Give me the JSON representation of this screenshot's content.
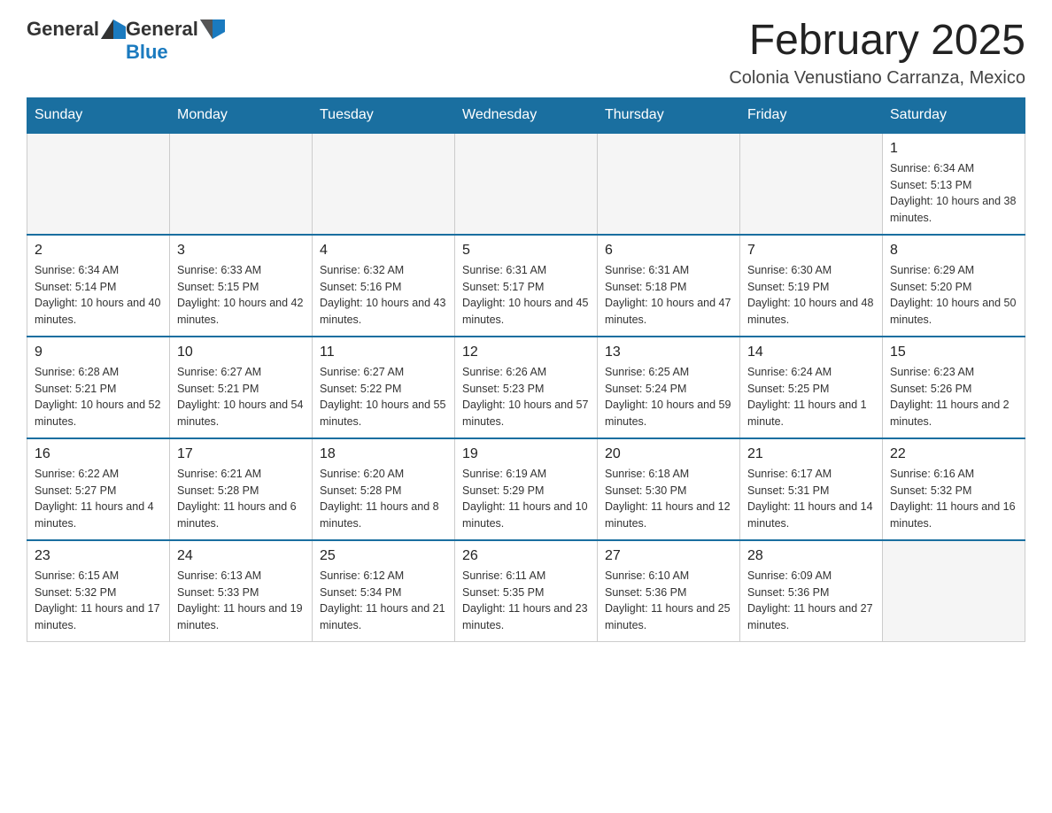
{
  "header": {
    "logo_general": "General",
    "logo_blue": "Blue",
    "month_title": "February 2025",
    "location": "Colonia Venustiano Carranza, Mexico"
  },
  "days_of_week": [
    "Sunday",
    "Monday",
    "Tuesday",
    "Wednesday",
    "Thursday",
    "Friday",
    "Saturday"
  ],
  "weeks": [
    [
      {
        "day": "",
        "info": ""
      },
      {
        "day": "",
        "info": ""
      },
      {
        "day": "",
        "info": ""
      },
      {
        "day": "",
        "info": ""
      },
      {
        "day": "",
        "info": ""
      },
      {
        "day": "",
        "info": ""
      },
      {
        "day": "1",
        "info": "Sunrise: 6:34 AM\nSunset: 5:13 PM\nDaylight: 10 hours and 38 minutes."
      }
    ],
    [
      {
        "day": "2",
        "info": "Sunrise: 6:34 AM\nSunset: 5:14 PM\nDaylight: 10 hours and 40 minutes."
      },
      {
        "day": "3",
        "info": "Sunrise: 6:33 AM\nSunset: 5:15 PM\nDaylight: 10 hours and 42 minutes."
      },
      {
        "day": "4",
        "info": "Sunrise: 6:32 AM\nSunset: 5:16 PM\nDaylight: 10 hours and 43 minutes."
      },
      {
        "day": "5",
        "info": "Sunrise: 6:31 AM\nSunset: 5:17 PM\nDaylight: 10 hours and 45 minutes."
      },
      {
        "day": "6",
        "info": "Sunrise: 6:31 AM\nSunset: 5:18 PM\nDaylight: 10 hours and 47 minutes."
      },
      {
        "day": "7",
        "info": "Sunrise: 6:30 AM\nSunset: 5:19 PM\nDaylight: 10 hours and 48 minutes."
      },
      {
        "day": "8",
        "info": "Sunrise: 6:29 AM\nSunset: 5:20 PM\nDaylight: 10 hours and 50 minutes."
      }
    ],
    [
      {
        "day": "9",
        "info": "Sunrise: 6:28 AM\nSunset: 5:21 PM\nDaylight: 10 hours and 52 minutes."
      },
      {
        "day": "10",
        "info": "Sunrise: 6:27 AM\nSunset: 5:21 PM\nDaylight: 10 hours and 54 minutes."
      },
      {
        "day": "11",
        "info": "Sunrise: 6:27 AM\nSunset: 5:22 PM\nDaylight: 10 hours and 55 minutes."
      },
      {
        "day": "12",
        "info": "Sunrise: 6:26 AM\nSunset: 5:23 PM\nDaylight: 10 hours and 57 minutes."
      },
      {
        "day": "13",
        "info": "Sunrise: 6:25 AM\nSunset: 5:24 PM\nDaylight: 10 hours and 59 minutes."
      },
      {
        "day": "14",
        "info": "Sunrise: 6:24 AM\nSunset: 5:25 PM\nDaylight: 11 hours and 1 minute."
      },
      {
        "day": "15",
        "info": "Sunrise: 6:23 AM\nSunset: 5:26 PM\nDaylight: 11 hours and 2 minutes."
      }
    ],
    [
      {
        "day": "16",
        "info": "Sunrise: 6:22 AM\nSunset: 5:27 PM\nDaylight: 11 hours and 4 minutes."
      },
      {
        "day": "17",
        "info": "Sunrise: 6:21 AM\nSunset: 5:28 PM\nDaylight: 11 hours and 6 minutes."
      },
      {
        "day": "18",
        "info": "Sunrise: 6:20 AM\nSunset: 5:28 PM\nDaylight: 11 hours and 8 minutes."
      },
      {
        "day": "19",
        "info": "Sunrise: 6:19 AM\nSunset: 5:29 PM\nDaylight: 11 hours and 10 minutes."
      },
      {
        "day": "20",
        "info": "Sunrise: 6:18 AM\nSunset: 5:30 PM\nDaylight: 11 hours and 12 minutes."
      },
      {
        "day": "21",
        "info": "Sunrise: 6:17 AM\nSunset: 5:31 PM\nDaylight: 11 hours and 14 minutes."
      },
      {
        "day": "22",
        "info": "Sunrise: 6:16 AM\nSunset: 5:32 PM\nDaylight: 11 hours and 16 minutes."
      }
    ],
    [
      {
        "day": "23",
        "info": "Sunrise: 6:15 AM\nSunset: 5:32 PM\nDaylight: 11 hours and 17 minutes."
      },
      {
        "day": "24",
        "info": "Sunrise: 6:13 AM\nSunset: 5:33 PM\nDaylight: 11 hours and 19 minutes."
      },
      {
        "day": "25",
        "info": "Sunrise: 6:12 AM\nSunset: 5:34 PM\nDaylight: 11 hours and 21 minutes."
      },
      {
        "day": "26",
        "info": "Sunrise: 6:11 AM\nSunset: 5:35 PM\nDaylight: 11 hours and 23 minutes."
      },
      {
        "day": "27",
        "info": "Sunrise: 6:10 AM\nSunset: 5:36 PM\nDaylight: 11 hours and 25 minutes."
      },
      {
        "day": "28",
        "info": "Sunrise: 6:09 AM\nSunset: 5:36 PM\nDaylight: 11 hours and 27 minutes."
      },
      {
        "day": "",
        "info": ""
      }
    ]
  ]
}
